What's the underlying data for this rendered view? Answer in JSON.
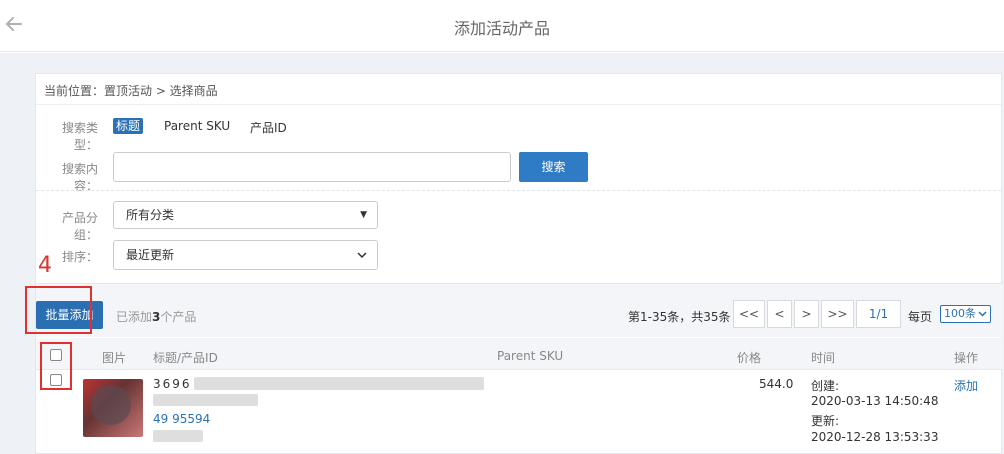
{
  "header": {
    "back_icon": "back-arrow-icon",
    "title": "添加活动产品"
  },
  "breadcrumb": {
    "text": "当前位置：置顶活动 > 选择商品"
  },
  "search_type": {
    "label": "搜索类型：",
    "options": [
      "标题",
      "Parent SKU",
      "产品ID"
    ],
    "selected": "标题"
  },
  "search_content": {
    "label": "搜索内容：",
    "value": "",
    "button": "搜索"
  },
  "group": {
    "label": "产品分组：",
    "value": "所有分类"
  },
  "sort": {
    "label": "排序：",
    "value": "最近更新"
  },
  "toolbar": {
    "batch_add": "批量添加",
    "added_prefix": "已添加",
    "added_count": "3",
    "added_suffix": "个产品",
    "annotation_number": "4"
  },
  "pagination": {
    "info": "第1-35条，共35条",
    "first": "<<",
    "prev": "<",
    "next": ">",
    "last": ">>",
    "page": "1/1",
    "per_page_label": "每页",
    "per_page_value": "100条"
  },
  "table": {
    "headers": {
      "image": "图片",
      "title": "标题/产品ID",
      "parent_sku": "Parent SKU",
      "price": "价格",
      "time": "时间",
      "action": "操作"
    },
    "rows": [
      {
        "title_start": "3696",
        "product_id": "49  95594",
        "price": "544.0",
        "created_label": "创建:",
        "created": "2020-03-13 14:50:48",
        "updated_label": "更新:",
        "updated": "2020-12-28 13:53:33",
        "action": "添加"
      }
    ]
  },
  "colors": {
    "accent": "#2b71b5",
    "annotation": "#e03030"
  }
}
